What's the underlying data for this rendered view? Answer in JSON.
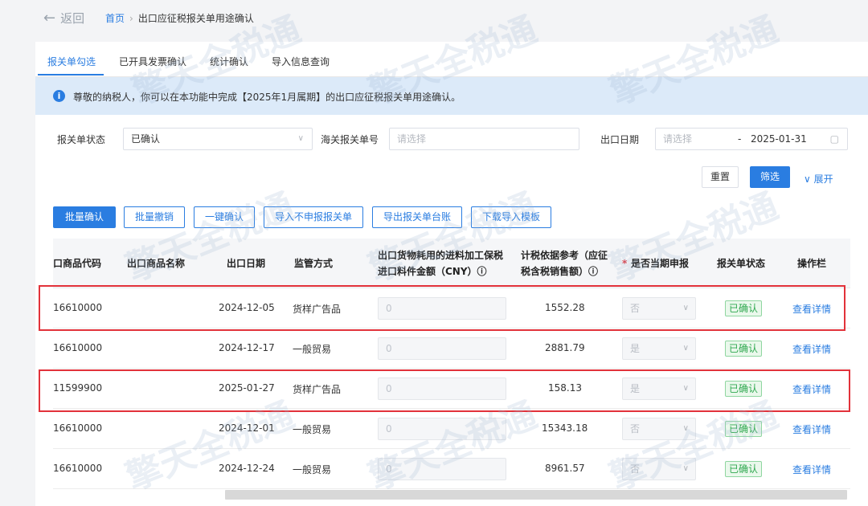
{
  "topbar": {
    "back_label": "返回",
    "breadcrumb_home": "首页",
    "breadcrumb_current": "出口应征税报关单用途确认"
  },
  "tabs": [
    "报关单勾选",
    "已开具发票确认",
    "统计确认",
    "导入信息查询"
  ],
  "notice": "尊敬的纳税人，你可以在本功能中完成【2025年1月属期】的出口应征税报关单用途确认。",
  "filters": {
    "status_label": "报关单状态",
    "status_value": "已确认",
    "customs_label": "海关报关单号",
    "customs_placeholder": "请选择",
    "date_label": "出口日期",
    "date_start_placeholder": "请选择",
    "date_sep": "-",
    "date_end": "2025-01-31"
  },
  "filter_buttons": {
    "reset": "重置",
    "filter": "筛选",
    "expand": "展开"
  },
  "actions": [
    "批量确认",
    "批量撤销",
    "一键确认",
    "导入不申报报关单",
    "导出报关单台账",
    "下载导入模板"
  ],
  "columns": {
    "code": "口商品代码",
    "name": "出口商品名称",
    "date": "出口日期",
    "method": "监管方式",
    "amount_line1": "出口货物耗用的进料加工保税",
    "amount_line2": "进口料件金额（CNY）ⓘ",
    "ref_line1": "计税依据参考（应征",
    "ref_line2": "税含税销售额）ⓘ",
    "current_star": "*",
    "current": "是否当期申报",
    "status": "报关单状态",
    "ops": "操作栏"
  },
  "rows": [
    {
      "code": "16610000",
      "name": "",
      "date": "2024-12-05",
      "method": "货样广告品",
      "amount": "0",
      "ref": "1552.28",
      "current": "否",
      "status": "已确认",
      "op": "查看详情"
    },
    {
      "code": "16610000",
      "name": "",
      "date": "2024-12-17",
      "method": "一般贸易",
      "amount": "0",
      "ref": "2881.79",
      "current": "是",
      "status": "已确认",
      "op": "查看详情"
    },
    {
      "code": "11599900",
      "name": "",
      "date": "2025-01-27",
      "method": "货样广告品",
      "amount": "0",
      "ref": "158.13",
      "current": "是",
      "status": "已确认",
      "op": "查看详情"
    },
    {
      "code": "16610000",
      "name": "",
      "date": "2024-12-01",
      "method": "一般贸易",
      "amount": "0",
      "ref": "15343.18",
      "current": "否",
      "status": "已确认",
      "op": "查看详情"
    },
    {
      "code": "16610000",
      "name": "",
      "date": "2024-12-24",
      "method": "一般贸易",
      "amount": "0",
      "ref": "8961.57",
      "current": "否",
      "status": "已确认",
      "op": "查看详情"
    }
  ],
  "watermark": "擎天全税通",
  "colors": {
    "accent": "#2a7de1",
    "highlight": "#e2323a",
    "success": "#2fa84f",
    "notice_bg": "#dceaf9"
  },
  "icons": {
    "back": "arrow-left-icon",
    "info": "info-icon",
    "dropdown": "chevron-down-icon",
    "calendar": "calendar-icon",
    "expand": "chevron-down-icon"
  }
}
